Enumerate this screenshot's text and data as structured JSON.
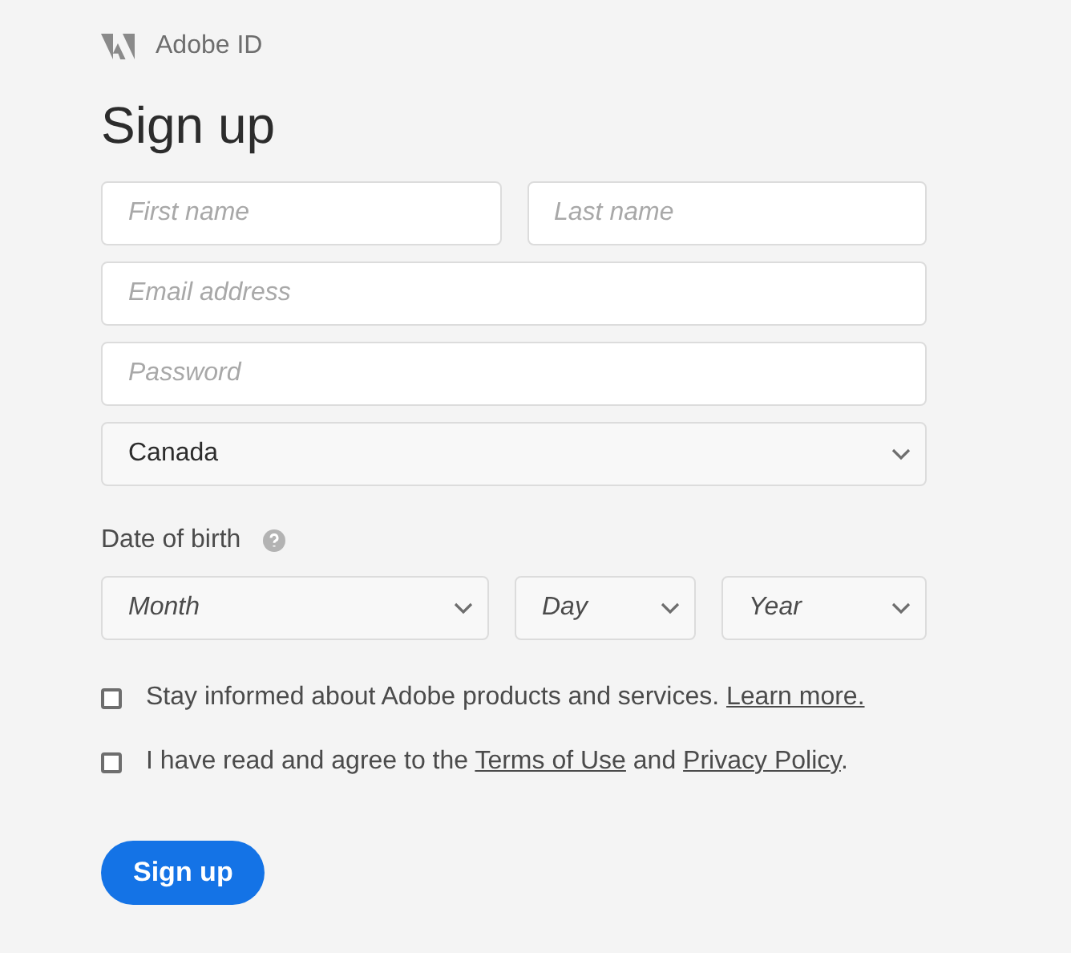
{
  "brand": {
    "name": "Adobe ID"
  },
  "title": "Sign up",
  "name_fields": [
    {
      "placeholder": "First name"
    },
    {
      "placeholder": "Last name"
    }
  ],
  "fields": [
    {
      "placeholder": "Email address"
    },
    {
      "placeholder": "Password"
    }
  ],
  "country": {
    "value": "Canada"
  },
  "date_of_birth": {
    "label": "Date of birth",
    "selects": [
      {
        "placeholder": "Month"
      },
      {
        "placeholder": "Day"
      },
      {
        "placeholder": "Year"
      }
    ]
  },
  "checkboxes": [
    {
      "checked": false,
      "parts": [
        {
          "kind": "text",
          "text": "Stay informed about Adobe products and services. "
        },
        {
          "kind": "link",
          "text": "Learn more."
        }
      ]
    },
    {
      "checked": false,
      "parts": [
        {
          "kind": "text",
          "text": "I have read and agree to the "
        },
        {
          "kind": "link",
          "text": "Terms of Use"
        },
        {
          "kind": "text",
          "text": " and "
        },
        {
          "kind": "link",
          "text": "Privacy Policy"
        },
        {
          "kind": "text",
          "text": "."
        }
      ]
    }
  ],
  "submit": {
    "label": "Sign up"
  }
}
